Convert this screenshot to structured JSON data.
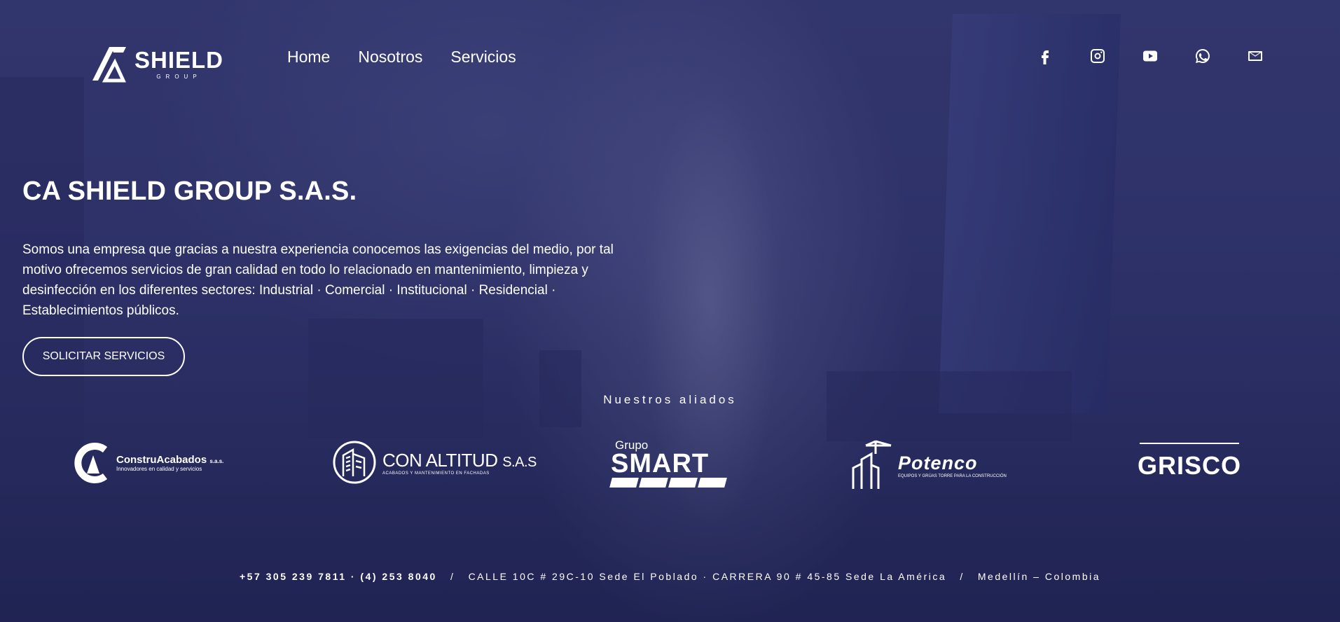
{
  "brand": {
    "word": "SHIELD",
    "sub": "GROUP"
  },
  "nav": [
    {
      "label": "Home"
    },
    {
      "label": "Nosotros"
    },
    {
      "label": "Servicios"
    }
  ],
  "social": [
    "facebook-icon",
    "instagram-icon",
    "youtube-icon",
    "whatsapp-icon",
    "mail-icon"
  ],
  "hero": {
    "title": "CA SHIELD GROUP S.A.S.",
    "description": "Somos una empresa que gracias a nuestra experiencia conocemos las exigencias del medio, por tal motivo ofrecemos servicios de gran calidad en todo lo relacionado en mantenimiento, limpieza y desinfección en los diferentes sectores: Industrial · Comercial · Institucional · Residencial · Establecimientos públicos.",
    "cta_label": "SOLICITAR SERVICIOS"
  },
  "allies": {
    "title": "Nuestros aliados",
    "items": [
      {
        "name": "ConstruAcabados",
        "suffix": "s.a.s.",
        "tagline": "Innovadores en calidad y servicios"
      },
      {
        "name": "CON ALTITUD",
        "suffix": "S.A.S",
        "tagline": "ACABADOS Y MANTENIMIENTO EN FACHADAS"
      },
      {
        "name": "SMART",
        "prefix": "Grupo"
      },
      {
        "name": "Potenco",
        "tagline": "EQUIPOS Y GRÚAS TORRE PARA LA CONSTRUCCIÓN"
      },
      {
        "name": "GRISCO"
      }
    ]
  },
  "footer": {
    "phone": "+57 305 239 7811 · (4) 253 8040",
    "sep1": "/",
    "address": "CALLE 10C # 29C-10 Sede El Poblado · CARRERA 90 # 45-85 Sede La América",
    "sep2": "/",
    "city": "Medellín – Colombia"
  },
  "colors": {
    "overlay": "#2c2f63",
    "text": "#ffffff"
  }
}
